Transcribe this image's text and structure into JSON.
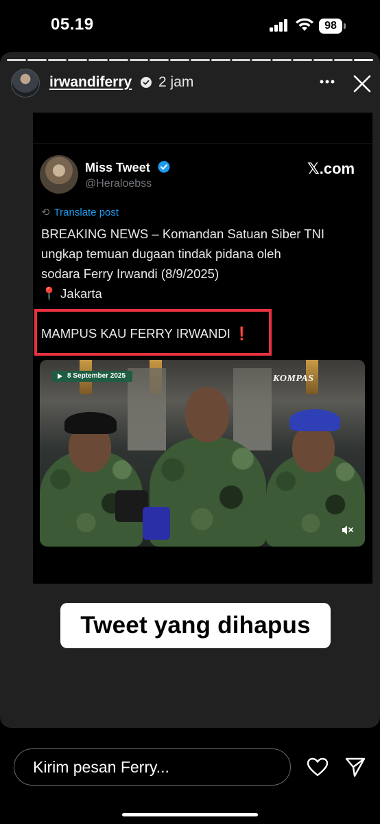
{
  "status_bar": {
    "time": "05.19",
    "battery": "98"
  },
  "story": {
    "progress": {
      "segments": 18,
      "current": 18
    },
    "header": {
      "username": "irwandiferry",
      "time_ago": "2 jam",
      "verified": true
    },
    "caption": "Tweet yang dihapus"
  },
  "tweet": {
    "author_name": "Miss Tweet",
    "author_handle": "@Heraloebss",
    "source": "𝕏.com",
    "translate_label": "Translate post",
    "body_lines": [
      "BREAKING NEWS – Komandan Satuan Siber TNI",
      "ungkap temuan dugaan tindak pidana oleh",
      "sodara Ferry Irwandi (8/9/2025)",
      "📍 Jakarta"
    ],
    "highlight_text": "MAMPUS KAU FERRY IRWANDI",
    "highlight_mark": "❗",
    "video": {
      "date_label": "8 September 2025",
      "brand": "KOMPAS"
    }
  },
  "reply_bar": {
    "placeholder": "Kirim pesan Ferry..."
  },
  "colors": {
    "highlight_border": "#e8323f",
    "link": "#1d9bf0",
    "story_bg": "#212121"
  }
}
